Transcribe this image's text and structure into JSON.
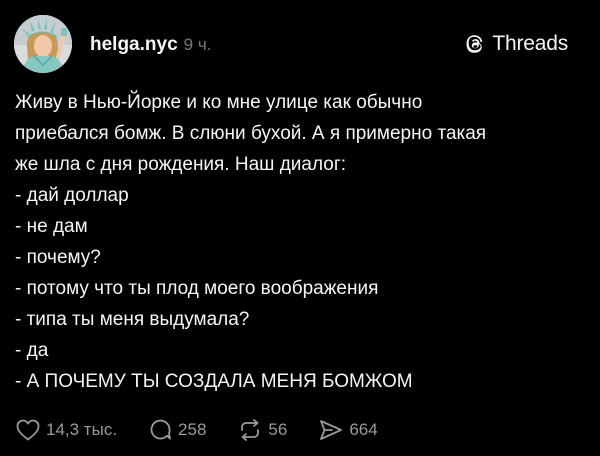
{
  "post": {
    "username": "helga.nyc",
    "timestamp": "9 ч.",
    "brand": "Threads",
    "avatar_icon": "avatar-statue-of-liberty-costume",
    "lines": [
      "Живу в Нью-Йорке и ко мне улице как обычно",
      "приебался бомж. В слюни бухой. А я примерно такая",
      "же шла с дня рождения. Наш диалог:",
      "- дай доллар",
      "- не дам",
      "- почему?",
      "- потому что ты плод моего воображения",
      "- типа ты меня выдумала?",
      "- да",
      "- А ПОЧЕМУ ТЫ СОЗДАЛА МЕНЯ БОМЖОМ"
    ],
    "actions": {
      "likes": "14,3 тыс.",
      "replies": "258",
      "reposts": "56",
      "shares": "664"
    }
  },
  "colors": {
    "background": "#000000",
    "text": "#f3f5f7",
    "muted": "#9a9a9a",
    "timestamp": "#777777"
  }
}
